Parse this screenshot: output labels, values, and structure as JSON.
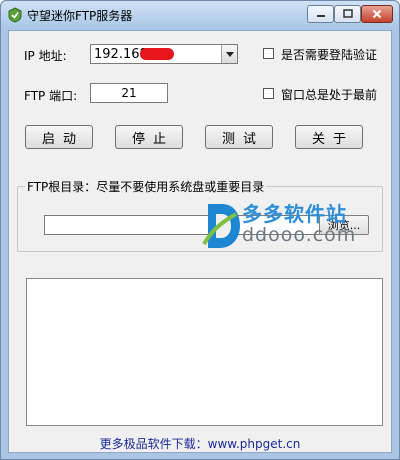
{
  "window": {
    "title": "守望迷你FTP服务器",
    "controls": [
      "minimize",
      "maximize",
      "close"
    ]
  },
  "ip": {
    "label": "IP 地址:",
    "value": "192.168"
  },
  "port": {
    "label": "FTP 端口:",
    "value": "21"
  },
  "options": {
    "require_login": "是否需要登陆验证",
    "always_on_top": "窗口总是处于最前"
  },
  "buttons": {
    "start": "启动",
    "stop": "停止",
    "test": "测试",
    "about": "关于"
  },
  "ftp_root": {
    "title": "FTP根目录：尽量不要使用系统盘或重要目录",
    "browse": "浏览..."
  },
  "watermark": {
    "text_cn": "多多软件站",
    "text_en": "ddooo.com"
  },
  "footer": {
    "link": "更多极品软件下载：www.phpget.cn"
  },
  "colors": {
    "frame": "#aac6e4",
    "client": "#f0f0f0",
    "link": "#1a2a96",
    "redaction": "#e8141b"
  }
}
